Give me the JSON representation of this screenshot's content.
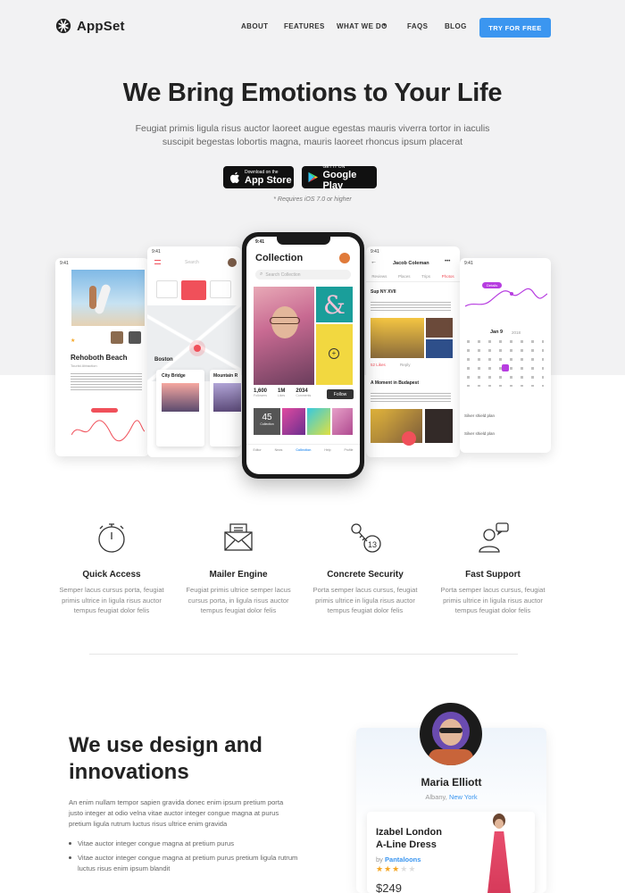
{
  "brand": {
    "name": "AppSet",
    "logo_icon": "appset-logo-icon"
  },
  "nav": {
    "items": [
      "ABOUT",
      "FEATURES",
      "WHAT WE DO",
      "FAQS",
      "BLOG"
    ],
    "cta": "TRY FOR FREE"
  },
  "hero": {
    "title": "We Bring Emotions to Your Life",
    "subtitle": "Feugiat primis ligula risus auctor laoreet augue egestas mauris viverra tortor in iaculis suscipit begestas lobortis magna, mauris laoreet rhoncus ipsum placerat",
    "appstore": {
      "small": "Download on the",
      "big": "App Store"
    },
    "googleplay": {
      "small": "GET IT ON",
      "big": "Google Play"
    },
    "note": "* Requires iOS 7.0 or higher"
  },
  "phone": {
    "time": "9:41",
    "title": "Collection",
    "search_placeholder": "Search Collection",
    "stats": [
      {
        "value": "1,600",
        "label": "Followers"
      },
      {
        "value": "1M",
        "label": "Likes"
      },
      {
        "value": "2034",
        "label": "Comments"
      }
    ],
    "follow": "Follow",
    "count": "45",
    "count_label": "Collection",
    "tabs": [
      "Editor",
      "News",
      "Collection",
      "Help",
      "Profile"
    ]
  },
  "screens": {
    "left": {
      "title": "Rehoboth Beach",
      "subtitle": "Tourist Attraction"
    },
    "map": {
      "search": "Search",
      "city": "Boston",
      "card1": "City Bridge",
      "card2": "Mountain R"
    },
    "feed": {
      "user": "Jacob Coleman",
      "tabs": [
        "Reviews",
        "Places",
        "Trips",
        "Photos"
      ],
      "post1": "Sup NY XVII",
      "post2": "A Moment in Budapest",
      "likes": "52 Likes",
      "reply": "Reply"
    },
    "calendar": {
      "month": "Jan 9",
      "year": "2018",
      "pill": "Details",
      "item1": "Silver shield plan",
      "item2": "Silver shield plan"
    }
  },
  "features": [
    {
      "icon": "stopwatch-icon",
      "title": "Quick Access",
      "text": "Semper lacus cursus porta, feugiat primis ultrice in ligula risus auctor tempus feugiat dolor felis"
    },
    {
      "icon": "envelope-icon",
      "title": "Mailer Engine",
      "text": "Feugiat primis ultrice semper lacus cursus porta, in ligula risus auctor tempus feugiat dolor felis"
    },
    {
      "icon": "keys-icon",
      "title": "Concrete Security",
      "text": "Porta semper lacus cursus, feugiat primis ultrice in ligula risus auctor tempus feugiat dolor felis"
    },
    {
      "icon": "support-user-icon",
      "title": "Fast Support",
      "text": "Porta semper lacus cursus, feugiat primis ultrice in ligula risus auctor tempus feugiat dolor felis"
    }
  ],
  "design": {
    "title_line1": "We use design and",
    "title_line2": "innovations",
    "text": "An enim nullam tempor sapien gravida donec enim ipsum pretium porta justo integer at odio velna vitae auctor integer congue magna at purus pretium ligula rutrum luctus risus ultrice enim gravida",
    "bullets": [
      "Vitae auctor integer congue magna at pretium purus",
      "Vitae auctor integer congue magna at pretium purus pretium ligula rutrum luctus risus enim ipsum blandit"
    ]
  },
  "profile": {
    "name": "Maria Elliott",
    "city": "Albany,",
    "region": "New York",
    "product_title_line1": "Izabel London",
    "product_title_line2": "A-Line Dress",
    "brand_prefix": "by",
    "brand": "Pantaloons",
    "rating": 3,
    "rating_max": 5,
    "price": "$249"
  },
  "colors": {
    "accent": "#3b96f0",
    "hero_bg": "#f2f2f3",
    "star": "#f5a623",
    "red": "#f0505a"
  }
}
